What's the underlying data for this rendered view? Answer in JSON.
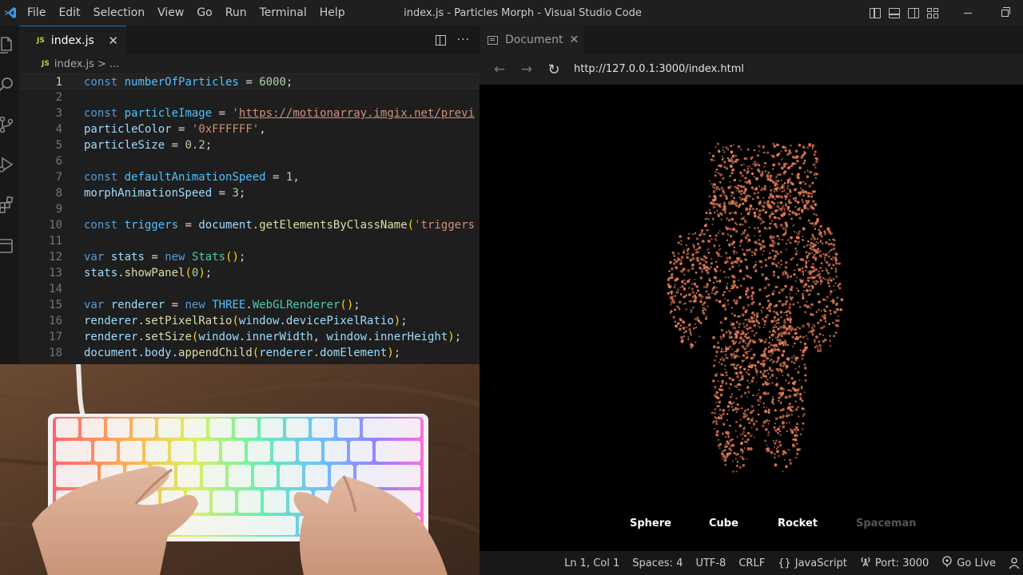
{
  "window": {
    "title": "index.js - Particles Morph - Visual Studio Code"
  },
  "menu": [
    "File",
    "Edit",
    "Selection",
    "View",
    "Go",
    "Run",
    "Terminal",
    "Help"
  ],
  "editor": {
    "tab": {
      "badge": "JS",
      "label": "index.js",
      "close": "✕"
    },
    "breadcrumb": {
      "badge": "JS",
      "file": "index.js",
      "sep": ">",
      "rest": "..."
    },
    "more": "···",
    "line_numbers": [
      "1",
      "2",
      "3",
      "4",
      "5",
      "6",
      "7",
      "8",
      "9",
      "10",
      "11",
      "12",
      "13",
      "14",
      "15",
      "16",
      "17",
      "18"
    ]
  },
  "preview": {
    "tab_label": "Document",
    "tab_close": "✕",
    "url": "http://127.0.0.1:3000/index.html",
    "triggers": [
      "Sphere",
      "Cube",
      "Rocket",
      "Spaceman"
    ],
    "active_trigger": "Spaceman",
    "particle_color": "#e07a56"
  },
  "statusbar": {
    "position": "Ln 1, Col 1",
    "spaces": "Spaces: 4",
    "encoding": "UTF-8",
    "eol": "CRLF",
    "language_icon": "{}",
    "language": "JavaScript",
    "port": "Port: 3000",
    "golive": "Go Live"
  },
  "colors": {
    "accent": "#0078d4",
    "js_badge": "#cbcb41",
    "background": "#1e1e1e"
  }
}
